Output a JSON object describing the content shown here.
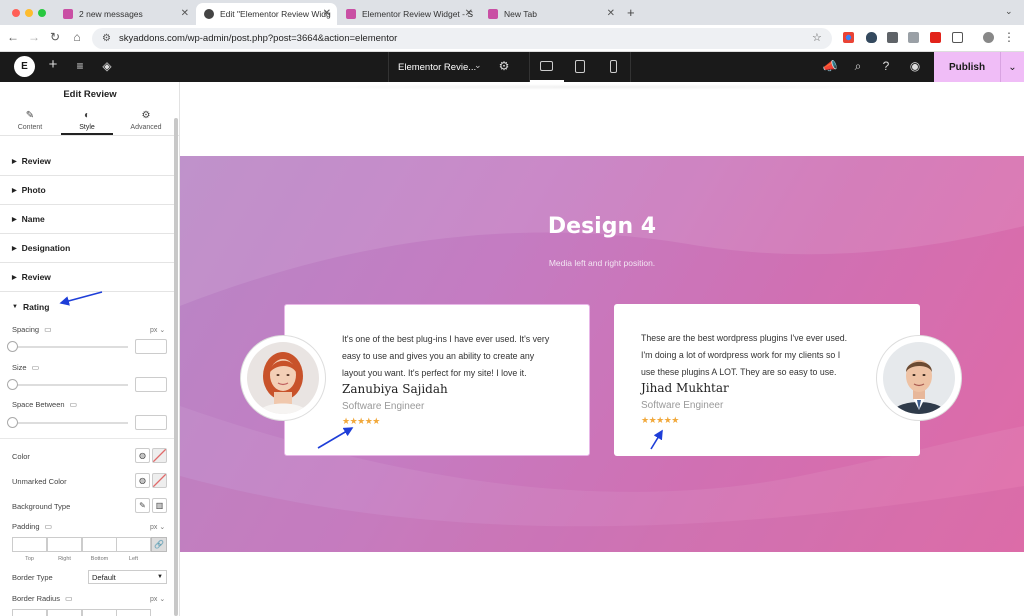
{
  "browser": {
    "tabs": [
      {
        "title": "2 new messages",
        "favicon_color": "#c94fa4"
      },
      {
        "title": "Edit \"Elementor Review Widg",
        "favicon_color": "#444444"
      },
      {
        "title": "Elementor Review Widget - S",
        "favicon_color": "#c94fa4"
      },
      {
        "title": "New Tab",
        "favicon_color": "#c94fa4"
      }
    ],
    "url": "skyaddons.com/wp-admin/post.php?post=3664&action=elementor"
  },
  "topbar": {
    "logo": "E",
    "document_name": "Elementor Revie...",
    "publish_label": "Publish"
  },
  "panel": {
    "title": "Edit Review",
    "tabs": [
      {
        "label": "Content",
        "icon": "pencil-icon"
      },
      {
        "label": "Style",
        "icon": "contrast-icon"
      },
      {
        "label": "Advanced",
        "icon": "gear-icon"
      }
    ],
    "sections": [
      "Review",
      "Photo",
      "Name",
      "Designation",
      "Review"
    ],
    "open_section": "Rating",
    "controls": {
      "spacing": "Spacing",
      "size": "Size",
      "space_between": "Space Between",
      "unit": "px",
      "color": "Color",
      "unmarked_color": "Unmarked Color",
      "background_type": "Background Type",
      "padding": "Padding",
      "padding_sides": [
        "Top",
        "Right",
        "Bottom",
        "Left"
      ],
      "border_type": "Border Type",
      "border_type_value": "Default",
      "border_radius": "Border Radius"
    }
  },
  "preview": {
    "title": "Design 4",
    "subtitle": "Media left and right position.",
    "reviews": [
      {
        "text_lines": [
          "It's one of the best plug-ins I have ever used. It's very",
          "easy to use and gives you an ability to create any",
          "layout you want. It's perfect for my site! I love it."
        ],
        "name": "Zanubiya Sajidah",
        "designation": "Software Engineer",
        "rating": 5,
        "stars": "★★★★★"
      },
      {
        "text_lines": [
          "These are the best wordpress plugins I've ever used.",
          "I'm doing a lot of wordpress work for my clients so I",
          "use these plugins A LOT. They are so easy to use."
        ],
        "name": "Jihad Mukhtar",
        "designation": "Software Engineer",
        "rating": 5,
        "stars": "★★★★★"
      }
    ]
  },
  "colors": {
    "publish_bg": "#f0bdf7",
    "banner_start": "#b886c6",
    "banner_end": "#e06aa6",
    "star": "#f1a83a",
    "annotation_arrow": "#1e3ed8"
  }
}
